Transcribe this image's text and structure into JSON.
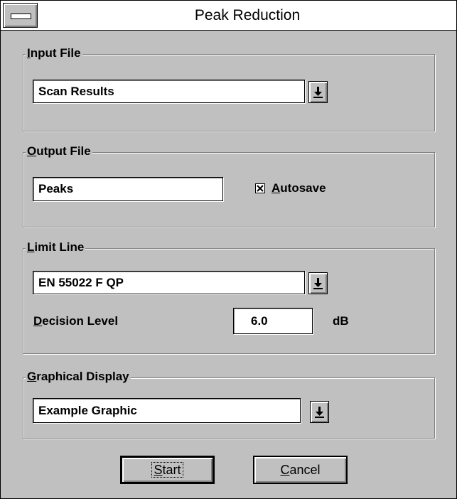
{
  "window": {
    "title": "Peak Reduction"
  },
  "input_file": {
    "group_label": "Input File",
    "accel": "I",
    "rest": "nput File",
    "selected": "Scan Results"
  },
  "output_file": {
    "accel": "O",
    "rest": "utput File",
    "value": "Peaks",
    "autosave": {
      "checked": true,
      "accel": "A",
      "rest": "utosave"
    }
  },
  "limit_line": {
    "accel": "L",
    "rest": "imit Line",
    "selected": "EN 55022 F QP",
    "decision_level": {
      "accel": "D",
      "rest": "ecision Level",
      "value": "6.0",
      "unit": "dB"
    }
  },
  "graphical_display": {
    "accel": "G",
    "rest": "raphical Display",
    "selected": "Example Graphic"
  },
  "buttons": {
    "start": {
      "accel": "S",
      "rest": "tart"
    },
    "cancel": {
      "accel": "C",
      "rest": "ancel"
    }
  }
}
